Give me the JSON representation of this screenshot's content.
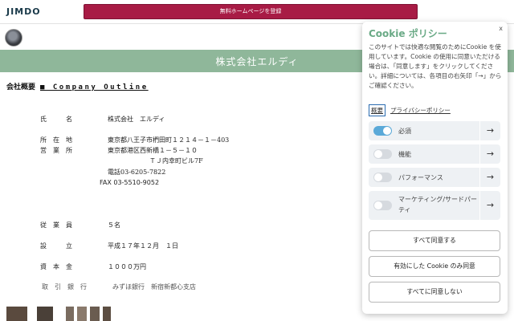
{
  "header": {
    "logo": "JIMDO",
    "register_button": "無料ホームページを登録"
  },
  "banner": {
    "title": "株式会社エルディ"
  },
  "company": {
    "heading_jp": "会社概要",
    "heading_en": "■ Company Outline",
    "name_label": "氏　　　名",
    "name_value": "株式会社　エルディ",
    "address_label": "所　在　地",
    "address_value": "東京都八王子市椚田町１２１４－１－403",
    "office_label": "営　業　所",
    "office_value_1": "東京都港区西新橋１－５－１０",
    "office_value_2": "ＴＪ内幸町ビル7F",
    "phone": "電話03-6205-7822",
    "fax": "FAX 03-5510-9052",
    "employees_label": "従　業　員",
    "employees_value": "５名",
    "founded_label": "設　　　立",
    "founded_value": "平成１７年１２月　１日",
    "capital_label": "資　本　金",
    "capital_value": "１０００万円",
    "bank_label": "取　引　銀　行",
    "bank_value": "みずほ銀行　新宿新都心支店"
  },
  "cookie": {
    "close": "x",
    "title": "Cookie ポリシー",
    "description": "このサイトでは快適な閲覧のためにCookie を使用しています。Cookie の使用に同意いただける場合は、「同意します」をクリックしてください。詳細については、各項目の右矢印「→」からご確認ください。",
    "link_summary": "概要",
    "link_privacy": "プライバシーポリシー",
    "categories": [
      {
        "label": "必須",
        "enabled": true
      },
      {
        "label": "機能",
        "enabled": false
      },
      {
        "label": "パフォーマンス",
        "enabled": false
      },
      {
        "label": "マーケティング/サードパーティ",
        "enabled": false
      }
    ],
    "arrow": "→",
    "accept_all": "すべて同意する",
    "accept_selected": "有効にした Cookie のみ同意",
    "reject_all": "すべてに同意しない"
  },
  "colors": {
    "brand_green": "#8fb79a",
    "cookie_title": "#6aaa86",
    "register_red": "#a81b45",
    "toggle_on": "#5aa9d8"
  }
}
